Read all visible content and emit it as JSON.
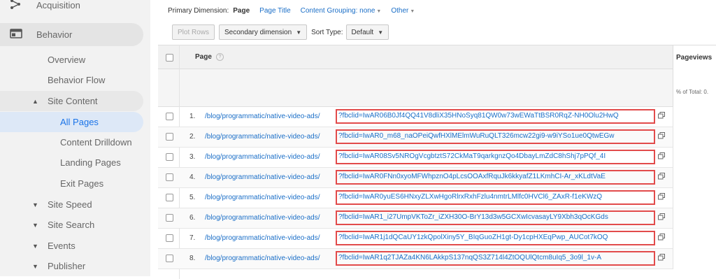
{
  "sidebar": {
    "acquisition": "Acquisition",
    "behavior": "Behavior",
    "items": [
      {
        "label": "Overview"
      },
      {
        "label": "Behavior Flow"
      },
      {
        "label": "Site Content"
      },
      {
        "label": "All Pages"
      },
      {
        "label": "Content Drilldown"
      },
      {
        "label": "Landing Pages"
      },
      {
        "label": "Exit Pages"
      },
      {
        "label": "Site Speed"
      },
      {
        "label": "Site Search"
      },
      {
        "label": "Events"
      },
      {
        "label": "Publisher"
      }
    ]
  },
  "dimension": {
    "label": "Primary Dimension:",
    "active": "Page",
    "page_title": "Page Title",
    "content_grouping": "Content Grouping: none",
    "other": "Other"
  },
  "toolbar": {
    "plot_rows": "Plot Rows",
    "secondary_dimension": "Secondary dimension",
    "sort_type_label": "Sort Type:",
    "sort_type_value": "Default"
  },
  "table": {
    "col_page": "Page",
    "col_pageviews": "Pageviews",
    "pct_total": "% of Total: 0.",
    "rows": [
      {
        "num": "1.",
        "path": "/blog/programmatic/native-video-ads/",
        "query": "?fbclid=IwAR06B0Jf4QQ41V8dliX35HNoSyq81QW0w73wEWaTtBSR0RqZ-NH0Olu2HwQ"
      },
      {
        "num": "2.",
        "path": "/blog/programmatic/native-video-ads/",
        "query": "?fbclid=IwAR0_m68_naOPeiQwfHXlMElmWuRuQLT326mcw22gi9-w9iYSo1ue0QtwEGw"
      },
      {
        "num": "3.",
        "path": "/blog/programmatic/native-video-ads/",
        "query": "?fbclid=IwAR08Sv5NROgVcgbtztS72CkMaT9qarkgnzQo4DbayLmZdC8hShj7pPQf_4I"
      },
      {
        "num": "4.",
        "path": "/blog/programmatic/native-video-ads/",
        "query": "?fbclid=IwAR0FNn0xyoMFWhpznO4pLcsOOAxfRquJk6kkyafZ1LKmhCI-Ar_xKLdtVaE"
      },
      {
        "num": "5.",
        "path": "/blog/programmatic/native-video-ads/",
        "query": "?fbclid=IwAR0yuES6HNxyZLXwHgoRlrxRxhFzlu4nmtrLMlfc0HVCl6_ZAxR-f1eKWzQ"
      },
      {
        "num": "6.",
        "path": "/blog/programmatic/native-video-ads/",
        "query": "?fbclid=IwAR1_i27UmpVKToZr_iZXH30O-BrY13d3w5GCXwIcvasayLY9Xbh3qOcKGds"
      },
      {
        "num": "7.",
        "path": "/blog/programmatic/native-video-ads/",
        "query": "?fbclid=IwAR1j1dQCaUY1zkQpolXiny5Y_BIqGuoZH1gt-Dy1cpHXEqPwp_AUCot7kOQ"
      },
      {
        "num": "8.",
        "path": "/blog/programmatic/native-video-ads/",
        "query": "?fbclid=IwAR1q2TJAZa4KN6LAkkpS137nqQS3Z714l4ZtOQUlQtcm8uIq5_3o9l_1v-A"
      }
    ]
  },
  "colors": {
    "accent": "#1a73e8",
    "link": "#1a6ec7",
    "highlight_border": "#e24b4b"
  }
}
